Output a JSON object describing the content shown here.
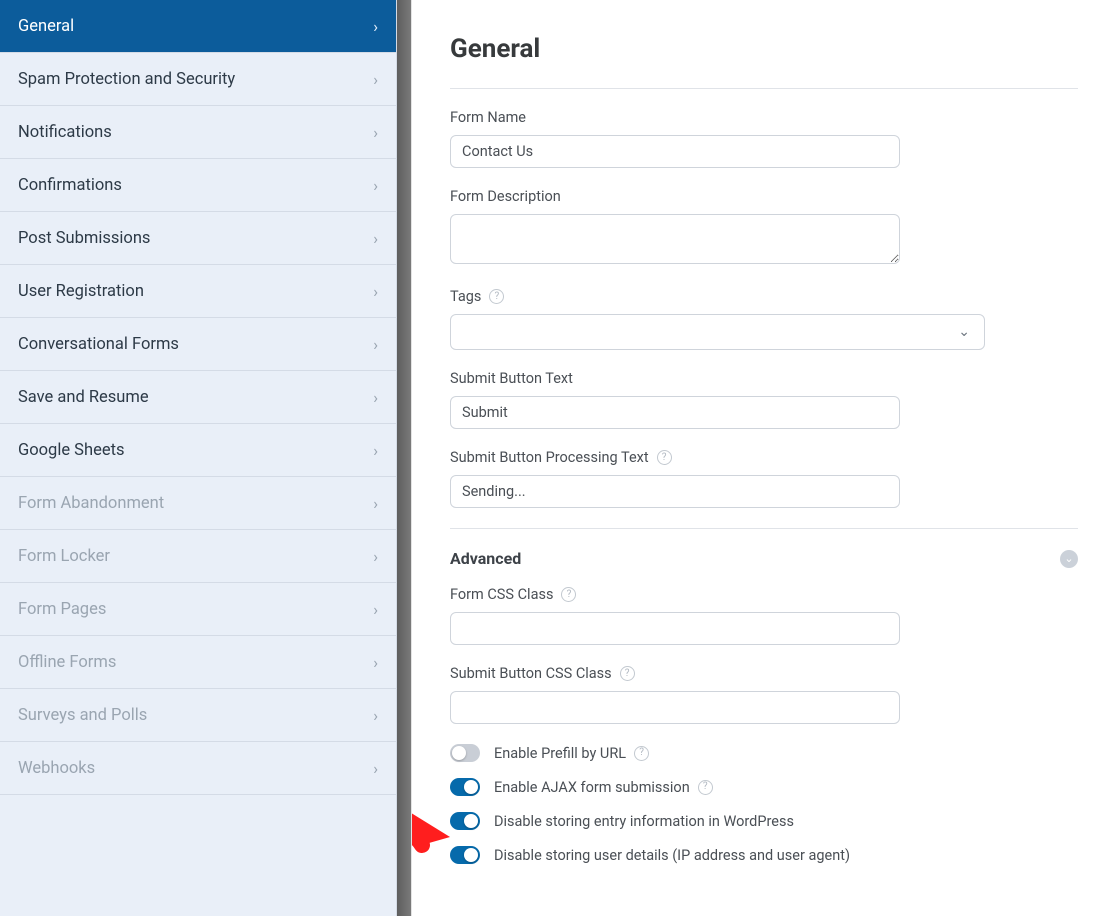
{
  "page": {
    "title": "General"
  },
  "sidebar": {
    "items": [
      {
        "label": "General",
        "state": "active"
      },
      {
        "label": "Spam Protection and Security",
        "state": ""
      },
      {
        "label": "Notifications",
        "state": ""
      },
      {
        "label": "Confirmations",
        "state": ""
      },
      {
        "label": "Post Submissions",
        "state": ""
      },
      {
        "label": "User Registration",
        "state": ""
      },
      {
        "label": "Conversational Forms",
        "state": ""
      },
      {
        "label": "Save and Resume",
        "state": ""
      },
      {
        "label": "Google Sheets",
        "state": ""
      },
      {
        "label": "Form Abandonment",
        "state": "disabled"
      },
      {
        "label": "Form Locker",
        "state": "disabled"
      },
      {
        "label": "Form Pages",
        "state": "disabled"
      },
      {
        "label": "Offline Forms",
        "state": "disabled"
      },
      {
        "label": "Surveys and Polls",
        "state": "disabled"
      },
      {
        "label": "Webhooks",
        "state": "disabled"
      }
    ]
  },
  "form": {
    "form_name_label": "Form Name",
    "form_name_value": "Contact Us",
    "form_desc_label": "Form Description",
    "form_desc_value": "",
    "tags_label": "Tags",
    "tags_value": "",
    "submit_btn_label": "Submit Button Text",
    "submit_btn_value": "Submit",
    "submit_proc_label": "Submit Button Processing Text",
    "submit_proc_value": "Sending..."
  },
  "advanced": {
    "title": "Advanced",
    "css_class_label": "Form CSS Class",
    "css_class_value": "",
    "btn_css_label": "Submit Button CSS Class",
    "btn_css_value": ""
  },
  "toggles": {
    "prefill": {
      "label": "Enable Prefill by URL",
      "on": false,
      "help": true
    },
    "ajax": {
      "label": "Enable AJAX form submission",
      "on": true,
      "help": true
    },
    "nostore": {
      "label": "Disable storing entry information in WordPress",
      "on": true,
      "help": false
    },
    "nouser": {
      "label": "Disable storing user details (IP address and user agent)",
      "on": true,
      "help": false
    }
  }
}
